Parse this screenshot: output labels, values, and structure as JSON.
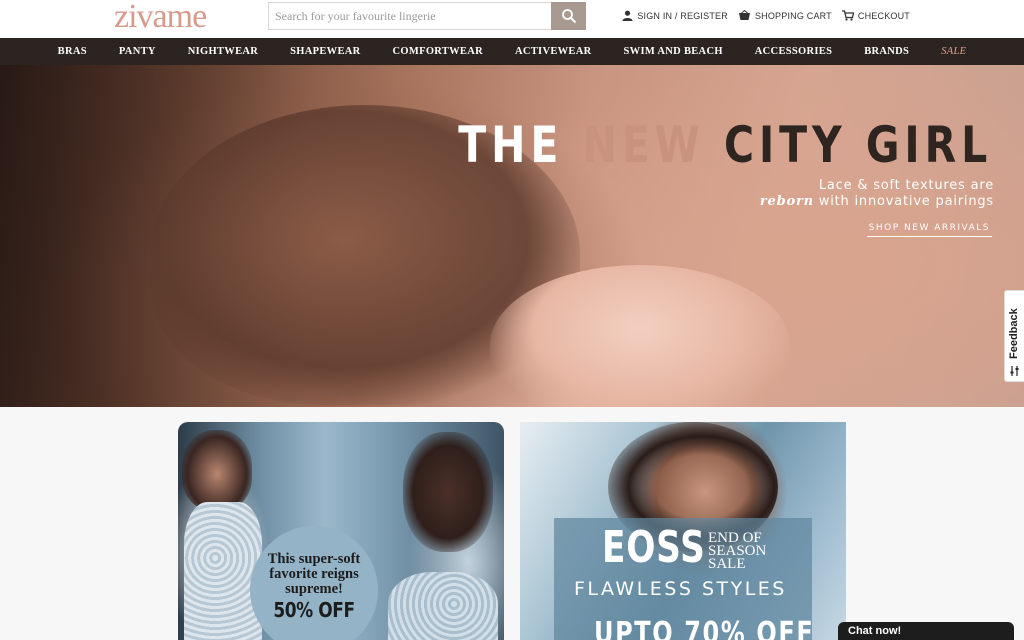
{
  "header": {
    "logo_text": "zivame",
    "search": {
      "placeholder": "Search for your favourite lingerie",
      "value": ""
    },
    "links": {
      "signin": "SIGN IN / REGISTER",
      "cart": "SHOPPING CART",
      "checkout": "CHECKOUT"
    }
  },
  "nav": {
    "items": [
      "BRAS",
      "PANTY",
      "NIGHTWEAR",
      "SHAPEWEAR",
      "COMFORTWEAR",
      "ACTIVEWEAR",
      "SWIM AND BEACH",
      "ACCESSORIES",
      "BRANDS",
      "SALE"
    ]
  },
  "hero": {
    "title_the": "THE",
    "title_new": "NEW",
    "title_city": "CITY GIRL",
    "sub_line1": "Lace & soft textures are",
    "sub_em": "reborn",
    "sub_line2_rest": " with innovative pairings",
    "cta": "SHOP NEW ARRIVALS"
  },
  "promos": {
    "left": {
      "text": "This super-soft favorite reigns supreme!",
      "offer": "50% OFF"
    },
    "right": {
      "headline": "EOSS",
      "sub": "END OF SEASON SALE",
      "tagline": "FLAWLESS STYLES",
      "offer": "UPTO 70% OFF"
    }
  },
  "feedback": {
    "label": "Feedback"
  },
  "chat": {
    "label": "Chat now!"
  },
  "colors": {
    "nav_bg": "#2b2421",
    "logo": "#d89a8c",
    "sale": "#e3a08f",
    "search_btn": "#a89a90"
  }
}
